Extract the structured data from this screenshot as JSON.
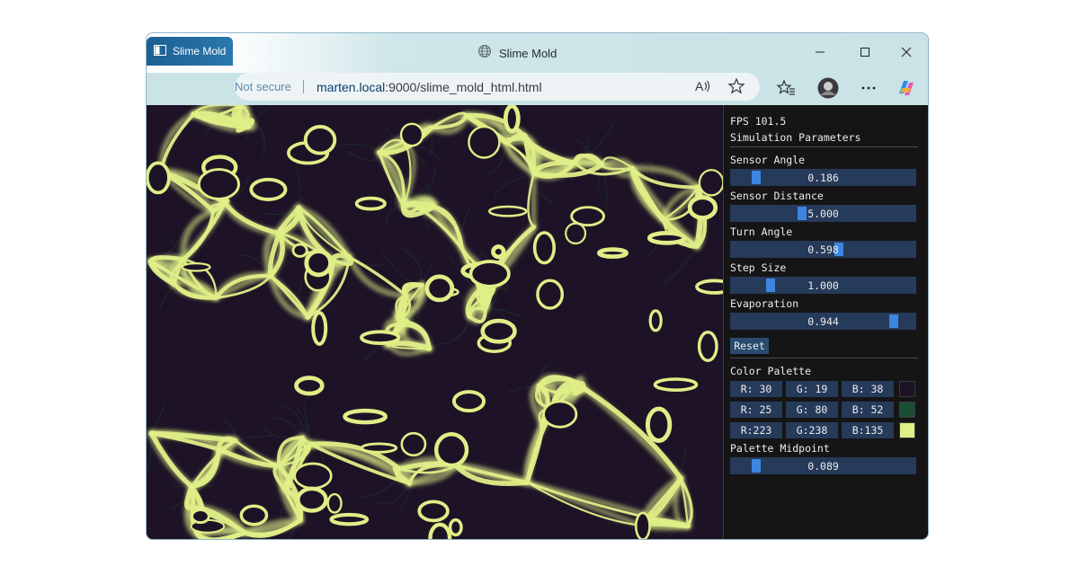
{
  "window": {
    "title": "Slime Mold"
  },
  "tab": {
    "label": "Slime Mold"
  },
  "address": {
    "security_label": "Not secure",
    "url_host": "marten.local",
    "url_rest": ":9000/slime_mold_html.html"
  },
  "icons": {
    "globe": "globe-icon",
    "minimize": "minimize-icon",
    "maximize": "maximize-icon",
    "close": "close-icon",
    "read_aloud": "read-aloud-icon",
    "favorite": "star-icon",
    "favorites": "favorites-icon",
    "profile": "avatar",
    "more": "more-icon",
    "copilot": "copilot-icon"
  },
  "panel": {
    "fps": "FPS 101.5",
    "heading": "Simulation Parameters",
    "params": [
      {
        "label": "Sensor Angle",
        "value": "0.186",
        "fraction": 0.12
      },
      {
        "label": "Sensor Distance",
        "value": "5.000",
        "fraction": 0.38
      },
      {
        "label": "Turn Angle",
        "value": "0.598",
        "fraction": 0.59
      },
      {
        "label": "Step Size",
        "value": "1.000",
        "fraction": 0.2
      },
      {
        "label": "Evaporation",
        "value": "0.944",
        "fraction": 0.9
      }
    ],
    "reset_label": "Reset",
    "palette_heading": "Color Palette",
    "palette": [
      {
        "r": "R: 30",
        "g": "G: 19",
        "b": "B: 38",
        "hex": "#1e1326"
      },
      {
        "r": "R: 25",
        "g": "G: 80",
        "b": "B: 52",
        "hex": "#195034"
      },
      {
        "r": "R:223",
        "g": "G:238",
        "b": "B:135",
        "hex": "#dfee87"
      }
    ],
    "midpoint_label": "Palette Midpoint",
    "midpoint_value": "0.089",
    "midpoint_fraction": 0.12
  },
  "colors": {
    "background": "#1e1326",
    "mid": "#195034",
    "bright": "#dfee87",
    "slider_bg": "#263a5a",
    "slider_grab": "#3d85e0"
  }
}
